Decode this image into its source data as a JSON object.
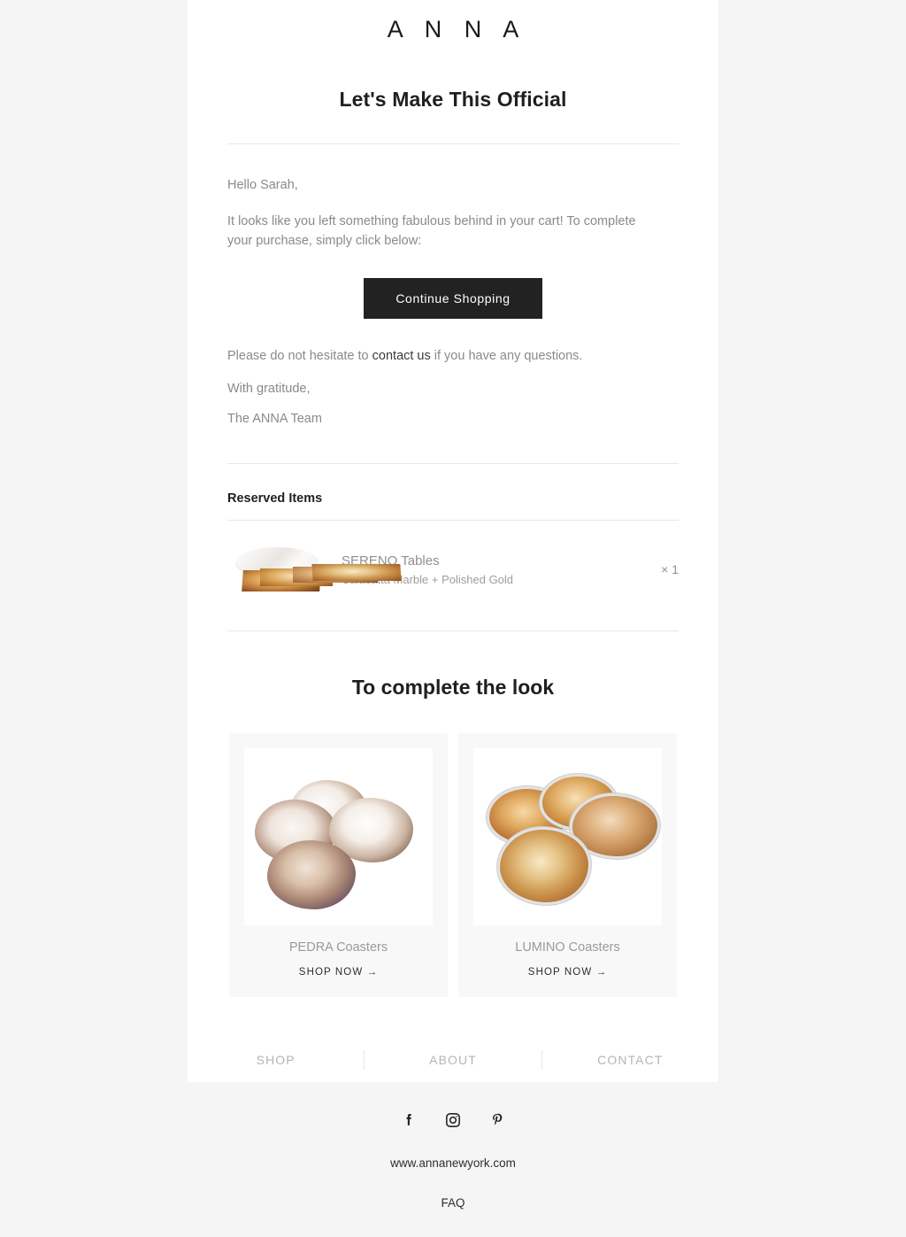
{
  "brand": {
    "logo": "A N N A"
  },
  "headline": "Let's Make This Official",
  "body": {
    "greeting": "Hello Sarah,",
    "intro": "It looks like you left something fabulous behind in your cart! To complete your purchase, simply click below:",
    "cta_label": "Continue Shopping",
    "outro_before": "Please do not hesitate to ",
    "outro_link": "contact us",
    "outro_after": " if you have any questions.",
    "signoff": "With gratitude,",
    "team": "The ANNA Team"
  },
  "reserved": {
    "section_label": "Reserved Items",
    "items": [
      {
        "name": "SERENO Tables",
        "variant": "Calacatta Marble + Polished Gold",
        "quantity": "× 1",
        "thumb_icon": "marble-oval-table-image"
      }
    ]
  },
  "recommendations": {
    "title": "To complete the look",
    "cards": [
      {
        "name": "PEDRA Coasters",
        "cta": "SHOP NOW →",
        "image_icon": "agate-coasters-neutral-image"
      },
      {
        "name": "LUMINO Coasters",
        "cta": "SHOP NOW →",
        "image_icon": "agate-coasters-amber-image"
      }
    ]
  },
  "footer_nav": [
    {
      "label": "SHOP"
    },
    {
      "label": "ABOUT"
    },
    {
      "label": "CONTACT"
    }
  ],
  "outer_footer": {
    "social": [
      {
        "name": "facebook-icon",
        "glyph": "f"
      },
      {
        "name": "instagram-icon",
        "glyph": ""
      },
      {
        "name": "pinterest-icon",
        "glyph": "P"
      }
    ],
    "site_url": "www.annanewyork.com",
    "faq_label": "FAQ"
  },
  "colors": {
    "page_background": "#f5f5f5",
    "card_background": "#ffffff",
    "button_background": "#222222",
    "button_text": "#ffffff",
    "body_text": "#8a8a8a",
    "heading_text": "#1f1f1f",
    "rule": "#e8e8e8",
    "reco_card_background": "#f8f8f8"
  }
}
